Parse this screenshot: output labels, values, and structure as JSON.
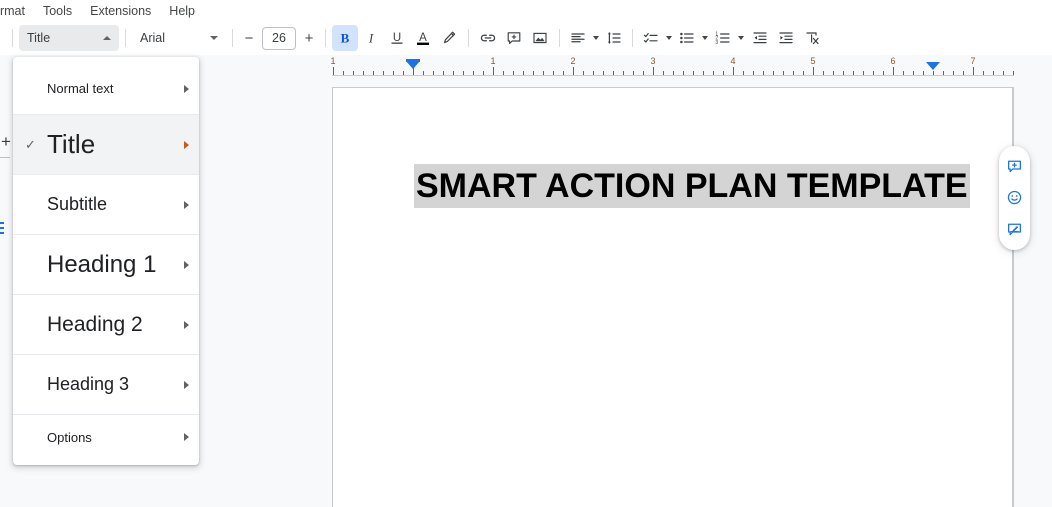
{
  "menubar": {
    "items": [
      {
        "label": "ormat",
        "name": "menu-format-clipped"
      },
      {
        "label": "Tools",
        "name": "menu-tools"
      },
      {
        "label": "Extensions",
        "name": "menu-extensions"
      },
      {
        "label": "Help",
        "name": "menu-help"
      }
    ]
  },
  "toolbar": {
    "paragraph_style": "Title",
    "font_family": "Arial",
    "font_size": "26",
    "decrease_size_label": "−",
    "increase_size_label": "+",
    "buttons": [
      {
        "name": "bold-button",
        "title": "Bold",
        "glyph": "B",
        "active": true
      },
      {
        "name": "italic-button",
        "title": "Italic",
        "glyph": "I",
        "active": false
      },
      {
        "name": "underline-button",
        "title": "Underline",
        "glyph": "U",
        "active": false
      },
      {
        "name": "text-color-button",
        "title": "Text color",
        "glyph": "A",
        "active": false
      },
      {
        "name": "highlight-color-button",
        "title": "Highlight color",
        "glyph": "pen",
        "active": false
      },
      {
        "name": "insert-link-button",
        "title": "Insert link",
        "glyph": "link",
        "active": false
      },
      {
        "name": "add-comment-button",
        "title": "Add comment",
        "glyph": "comment-plus",
        "active": false
      },
      {
        "name": "insert-image-button",
        "title": "Insert image",
        "glyph": "image",
        "active": false
      },
      {
        "name": "align-button",
        "title": "Align",
        "glyph": "align",
        "active": false
      },
      {
        "name": "line-spacing-button",
        "title": "Line & paragraph spacing",
        "glyph": "line-spacing",
        "active": false
      },
      {
        "name": "checklist-button",
        "title": "Checklist",
        "glyph": "checklist",
        "active": false
      },
      {
        "name": "bulleted-list-button",
        "title": "Bulleted list",
        "glyph": "bulleted-list",
        "active": false
      },
      {
        "name": "numbered-list-button",
        "title": "Numbered list",
        "glyph": "numbered-list",
        "active": false
      },
      {
        "name": "decrease-indent-button",
        "title": "Decrease indent",
        "glyph": "outdent",
        "active": false
      },
      {
        "name": "increase-indent-button",
        "title": "Increase indent",
        "glyph": "indent",
        "active": false
      },
      {
        "name": "clear-formatting-button",
        "title": "Clear formatting",
        "glyph": "clear-format",
        "active": false
      }
    ]
  },
  "ruler": {
    "numbers": [
      "1",
      "1",
      "2",
      "3",
      "4",
      "5",
      "6",
      "7"
    ],
    "unit": "inch",
    "left_indent_position_in": 0.5,
    "right_indent_position_in": 6.5
  },
  "styles_menu": {
    "items": [
      {
        "label": "Normal text",
        "name": "style-option-normal-text",
        "checked": false,
        "selected": false,
        "cls": "t-normal",
        "row": "normal-row"
      },
      {
        "label": "Title",
        "name": "style-option-title",
        "checked": true,
        "selected": true,
        "cls": "t-title",
        "row": ""
      },
      {
        "label": "Subtitle",
        "name": "style-option-subtitle",
        "checked": false,
        "selected": false,
        "cls": "t-subtitle",
        "row": ""
      },
      {
        "label": "Heading 1",
        "name": "style-option-heading-1",
        "checked": false,
        "selected": false,
        "cls": "t-h1",
        "row": ""
      },
      {
        "label": "Heading 2",
        "name": "style-option-heading-2",
        "checked": false,
        "selected": false,
        "cls": "t-h2",
        "row": ""
      },
      {
        "label": "Heading 3",
        "name": "style-option-heading-3",
        "checked": false,
        "selected": false,
        "cls": "t-h3",
        "row": ""
      },
      {
        "label": "Options",
        "name": "style-option-options",
        "checked": false,
        "selected": false,
        "cls": "t-options",
        "row": "opt"
      }
    ],
    "check_glyph": "✓"
  },
  "document": {
    "title_text": "SMART ACTION PLAN TEMPLATE",
    "title_highlight_color": "#d4d4d4"
  },
  "side_tools": {
    "items": [
      {
        "name": "add-comment-icon",
        "title": "Add comment"
      },
      {
        "name": "emoji-reaction-icon",
        "title": "Add emoji reaction"
      },
      {
        "name": "suggest-edits-icon",
        "title": "Show editing mode"
      }
    ]
  },
  "left_margin_widget": {
    "add_glyph": "+"
  },
  "colors": {
    "accent_blue": "#1a73e8",
    "toolbar_bg": "#ffffff",
    "canvas_bg": "#f8f9fb",
    "active_btn_bg": "#d3e3fd"
  }
}
